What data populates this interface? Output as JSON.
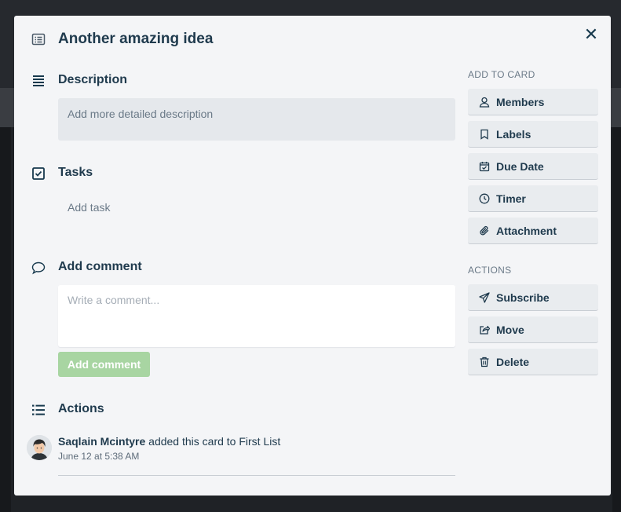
{
  "card": {
    "title": "Another amazing idea"
  },
  "description": {
    "heading": "Description",
    "placeholder": "Add more detailed description"
  },
  "tasks": {
    "heading": "Tasks",
    "add_label": "Add task"
  },
  "comment": {
    "heading": "Add comment",
    "placeholder": "Write a comment...",
    "button_label": "Add comment"
  },
  "actions_section": {
    "heading": "Actions",
    "entries": [
      {
        "user": "Saqlain Mcintyre",
        "text": "added this card to First List",
        "time": "June 12 at 5:38 AM"
      }
    ]
  },
  "sidebar": {
    "add_to_card_heading": "ADD TO CARD",
    "add_to_card": [
      {
        "label": "Members",
        "icon": "user-icon"
      },
      {
        "label": "Labels",
        "icon": "bookmark-icon"
      },
      {
        "label": "Due Date",
        "icon": "calendar-check-icon"
      },
      {
        "label": "Timer",
        "icon": "clock-icon"
      },
      {
        "label": "Attachment",
        "icon": "paperclip-icon"
      }
    ],
    "actions_heading": "ACTIONS",
    "actions": [
      {
        "label": "Subscribe",
        "icon": "paper-plane-icon"
      },
      {
        "label": "Move",
        "icon": "share-icon"
      },
      {
        "label": "Delete",
        "icon": "trash-icon"
      }
    ]
  },
  "colors": {
    "modal_bg": "#f4f5f7",
    "text_primary": "#1f3a4d",
    "muted": "#6b7a88",
    "sidebar_button_bg": "#e9ecef",
    "add_comment_button_bg": "#a8d5a2"
  }
}
